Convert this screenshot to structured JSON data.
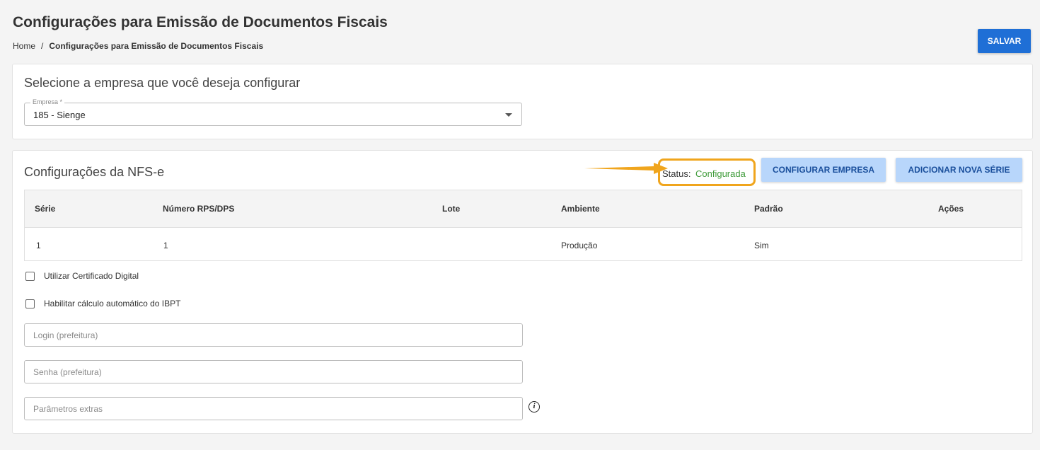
{
  "header": {
    "title": "Configurações para Emissão de Documentos Fiscais",
    "breadcrumb": {
      "home": "Home",
      "separator": "/",
      "current": "Configurações para Emissão de Documentos Fiscais"
    },
    "save_label": "SALVAR"
  },
  "company_card": {
    "title": "Selecione a empresa que você deseja configurar",
    "select_label": "Empresa *",
    "select_value": "185 - Sienge"
  },
  "nfse_card": {
    "title": "Configurações da NFS-e",
    "status_label": "Status:",
    "status_value": "Configurada",
    "configure_label": "CONFIGURAR EMPRESA",
    "add_series_label": "ADICIONAR NOVA SÉRIE",
    "table": {
      "columns": [
        "Série",
        "Número RPS/DPS",
        "Lote",
        "Ambiente",
        "Padrão",
        "Ações"
      ],
      "rows": [
        [
          "1",
          "1",
          "",
          "Produção",
          "Sim",
          ""
        ]
      ]
    },
    "checkboxes": [
      {
        "label": "Utilizar Certificado Digital",
        "checked": false
      },
      {
        "label": "Habilitar cálculo automático do IBPT",
        "checked": false
      }
    ],
    "inputs": {
      "login_placeholder": "Login (prefeitura)",
      "password_placeholder": "Senha (prefeitura)",
      "params_placeholder": "Parâmetros extras"
    },
    "info_icon": "i"
  },
  "colors": {
    "primary": "#1f6fd6",
    "light_button": "#b8d6fb",
    "status_ok": "#3f9b3a",
    "highlight": "#f0a51d"
  }
}
